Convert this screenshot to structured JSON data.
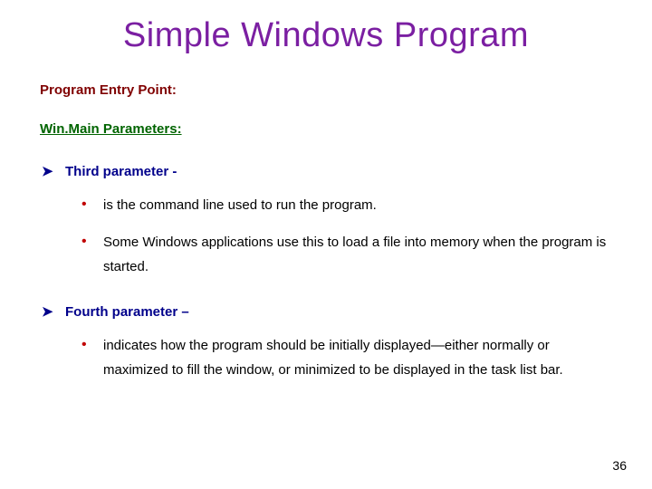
{
  "title": "Simple Windows Program",
  "section1": "Program Entry Point:",
  "section2": "Win.Main Parameters:",
  "param3": {
    "heading": "Third parameter -",
    "items": [
      "is the command line used to run the program.",
      "Some Windows applications use this to load a file into memory when the program is started."
    ]
  },
  "param4": {
    "heading": "Fourth parameter –",
    "items": [
      "indicates how the program should be initially displayed—either normally or maximized to fill the window, or minimized to be displayed in the task list bar."
    ]
  },
  "page_number": "36"
}
